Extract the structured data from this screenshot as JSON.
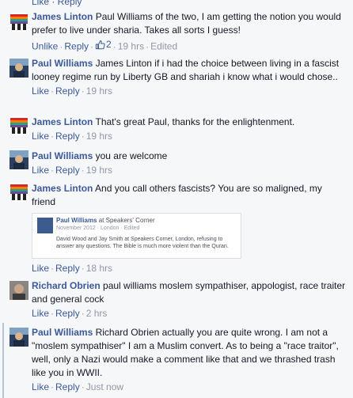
{
  "top_fragment": "Like · Reply",
  "comments": [
    {
      "author": "James Linton",
      "text": "Paul Williams of the two, I am getting the notion you would prefer to live under sharia. Takes all sorts I guess!",
      "unlike": "Unlike",
      "reply": "Reply",
      "likes": "2",
      "time": "19 hrs",
      "edited": "Edited"
    },
    {
      "author": "Paul Williams",
      "text": "James Linton if i had the choice between living in a fascist looney regime run by Liberty GB and shariah i know what i would chose..",
      "like": "Like",
      "reply": "Reply",
      "time": "19 hrs"
    },
    {
      "author": "James Linton",
      "text": "That's great Paul, thanks for the enlightenment.",
      "like": "Like",
      "reply": "Reply",
      "time": "19 hrs"
    },
    {
      "author": "Paul Williams",
      "text": "you are welcome",
      "like": "Like",
      "reply": "Reply",
      "time": "19 hrs"
    },
    {
      "author": "James Linton",
      "text": "And you call others fascists? You are so maligned, my friend",
      "like": "Like",
      "reply": "Reply",
      "time": "18 hrs",
      "shared_post": {
        "author": "Paul Williams",
        "location": "at Speakers' Corner",
        "sub": "November 2012 · London · Edited",
        "text": "David Wood and Jay Smith at Speakers Corner, London, refusing to answer any questions. The Bible is much more violent than the Quran."
      }
    },
    {
      "author": "Richard Obrien",
      "text": "paul williams moslem sympathiser, appologist, race traiter and general cock",
      "like": "Like",
      "reply": "Reply",
      "time": "2 hrs"
    },
    {
      "author": "Paul Williams",
      "text": "Richard Obrien actually you are quite wrong. I am not a \"moslem sympathiser\" I am a Muslim convert. As to being a \"race traitor\", well, only a Nazi would make a comment like that and we thrashed trash like you in WWII.",
      "like": "Like",
      "reply": "Reply",
      "time": "Just now"
    }
  ],
  "colors": {
    "link": "#3b5998",
    "meta": "#9197a3",
    "background": "#f6f7f9"
  }
}
